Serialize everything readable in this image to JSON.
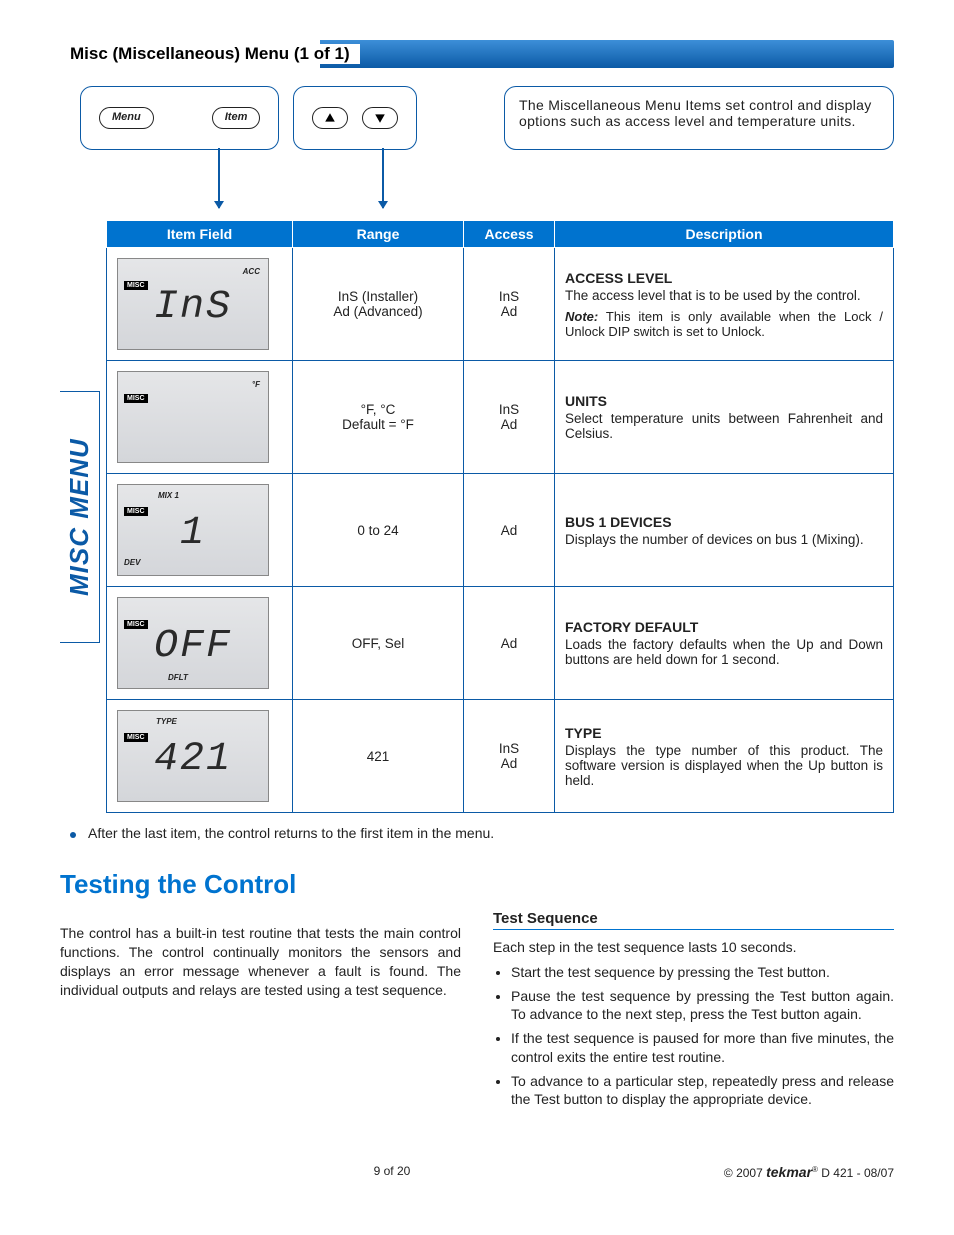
{
  "section_title": "Misc (Miscellaneous) Menu (1 of 1)",
  "buttons": {
    "menu": "Menu",
    "item": "Item"
  },
  "info_box": "The Miscellaneous Menu Items set control and display options such as access level and temperature units.",
  "side_label": "MISC MENU",
  "headers": {
    "item": "Item Field",
    "range": "Range",
    "access": "Access",
    "desc": "Description"
  },
  "rows": [
    {
      "lcd": {
        "misc": "MISC",
        "tr": "ACC",
        "seg": "InS"
      },
      "range_l1": "InS (Installer)",
      "range_l2": "Ad (Advanced)",
      "access_l1": "InS",
      "access_l2": "Ad",
      "title": "ACCESS LEVEL",
      "body": "The access level that is to be used by the control.",
      "note_label": "Note:",
      "note": "This item is only available when the Lock / Unlock DIP switch is set to Unlock."
    },
    {
      "lcd": {
        "misc": "MISC",
        "tr": "°F",
        "seg": ""
      },
      "range_l1": "°F, °C",
      "range_l2": "Default = °F",
      "access_l1": "InS",
      "access_l2": "Ad",
      "title": "UNITS",
      "body": "Select temperature units between Fahrenheit and Celsius."
    },
    {
      "lcd": {
        "misc": "MISC",
        "tl": "MIX 1",
        "bl": "DEV",
        "seg": "1"
      },
      "range_l1": "0 to 24",
      "access_l1": "Ad",
      "title": "BUS 1 DEVICES",
      "body": "Displays the number of devices on bus 1 (Mixing)."
    },
    {
      "lcd": {
        "misc": "MISC",
        "bc": "DFLT",
        "seg": "OFF"
      },
      "range_l1": "OFF, Sel",
      "access_l1": "Ad",
      "title": "FACTORY DEFAULT",
      "body": "Loads the factory defaults when the Up and Down buttons are held down for 1 second."
    },
    {
      "lcd": {
        "misc": "MISC",
        "tc": "TYPE",
        "seg": "421"
      },
      "range_l1": "421",
      "access_l1": "InS",
      "access_l2": "Ad",
      "title": "TYPE",
      "body": "Displays the type number of this product. The software version is displayed when the Up button is held."
    }
  ],
  "after_note": "After the last item, the control returns to the first item in the menu.",
  "testing": {
    "heading": "Testing the Control",
    "intro": "The control has a built-in test routine that tests the main control functions. The control continually monitors the sensors and displays an error message whenever a fault is found. The individual outputs and relays are tested using a test sequence.",
    "sub": "Test Sequence",
    "lead": "Each step in the test sequence lasts 10 seconds.",
    "steps": [
      "Start the test sequence by pressing the Test button.",
      "Pause the test sequence by pressing the Test button again. To advance to the next step, press the Test button again.",
      "If the test sequence is paused for more than five minutes, the control exits the entire test routine.",
      "To advance to a particular step, repeatedly press and release the Test button to display the appropriate device."
    ]
  },
  "footer": {
    "page": "9 of 20",
    "copyright": "© 2007",
    "brand": "tekmar",
    "doc": " D 421 - 08/07"
  }
}
